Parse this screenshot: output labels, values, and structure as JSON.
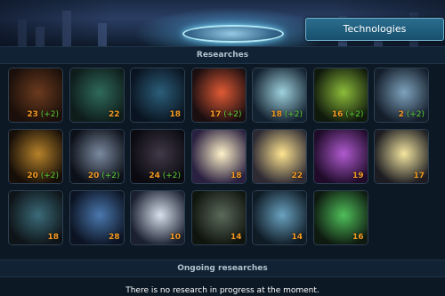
{
  "header": {
    "technologies_button": "Technologies"
  },
  "researches": {
    "title": "Researches",
    "items": [
      {
        "id": "r1",
        "level": "23",
        "bonus": "(+2)",
        "colors": [
          "#6b3a1e",
          "#1a0f0a"
        ]
      },
      {
        "id": "r2",
        "level": "22",
        "bonus": "",
        "colors": [
          "#2f6a5a",
          "#0e1c1a"
        ]
      },
      {
        "id": "r3",
        "level": "18",
        "bonus": "",
        "colors": [
          "#2b5e7a",
          "#0a1420"
        ]
      },
      {
        "id": "r4",
        "level": "17",
        "bonus": "(+2)",
        "colors": [
          "#e05a35",
          "#1b0e10"
        ]
      },
      {
        "id": "r5",
        "level": "18",
        "bonus": "(+2)",
        "colors": [
          "#9fd1de",
          "#142230"
        ]
      },
      {
        "id": "r6",
        "level": "16",
        "bonus": "(+2)",
        "colors": [
          "#8cbc3a",
          "#101a0c"
        ]
      },
      {
        "id": "r7",
        "level": "2",
        "bonus": "(+2)",
        "colors": [
          "#7ea3bd",
          "#141d2a"
        ]
      },
      {
        "id": "r8",
        "level": "20",
        "bonus": "(+2)",
        "colors": [
          "#b6822a",
          "#160e08"
        ]
      },
      {
        "id": "r9",
        "level": "20",
        "bonus": "(+2)",
        "colors": [
          "#7b8aa0",
          "#0c1018"
        ]
      },
      {
        "id": "r10",
        "level": "24",
        "bonus": "(+2)",
        "colors": [
          "#403848",
          "#0a0a10"
        ]
      },
      {
        "id": "r11",
        "level": "18",
        "bonus": "",
        "colors": [
          "#fff2c9",
          "#2a2040"
        ]
      },
      {
        "id": "r12",
        "level": "22",
        "bonus": "",
        "colors": [
          "#ffe490",
          "#2d2a34"
        ]
      },
      {
        "id": "r13",
        "level": "19",
        "bonus": "",
        "colors": [
          "#b05ad0",
          "#200c2a"
        ]
      },
      {
        "id": "r14",
        "level": "17",
        "bonus": "",
        "colors": [
          "#f4e6a0",
          "#1c1c22"
        ]
      },
      {
        "id": "r15",
        "level": "18",
        "bonus": "",
        "colors": [
          "#3a6a78",
          "#0e1418"
        ]
      },
      {
        "id": "r16",
        "level": "28",
        "bonus": "",
        "colors": [
          "#4a78ae",
          "#0c1424"
        ]
      },
      {
        "id": "r17",
        "level": "10",
        "bonus": "",
        "colors": [
          "#d8e0ec",
          "#1a2030"
        ]
      },
      {
        "id": "r18",
        "level": "14",
        "bonus": "",
        "colors": [
          "#5a6a5a",
          "#10140e"
        ]
      },
      {
        "id": "r19",
        "level": "14",
        "bonus": "",
        "colors": [
          "#6aa2c0",
          "#0e1a24"
        ]
      },
      {
        "id": "r20",
        "level": "16",
        "bonus": "",
        "colors": [
          "#4fbf5a",
          "#0e1a10"
        ]
      }
    ]
  },
  "ongoing": {
    "title": "Ongoing researches",
    "empty_message": "There is no research in progress at the moment."
  }
}
